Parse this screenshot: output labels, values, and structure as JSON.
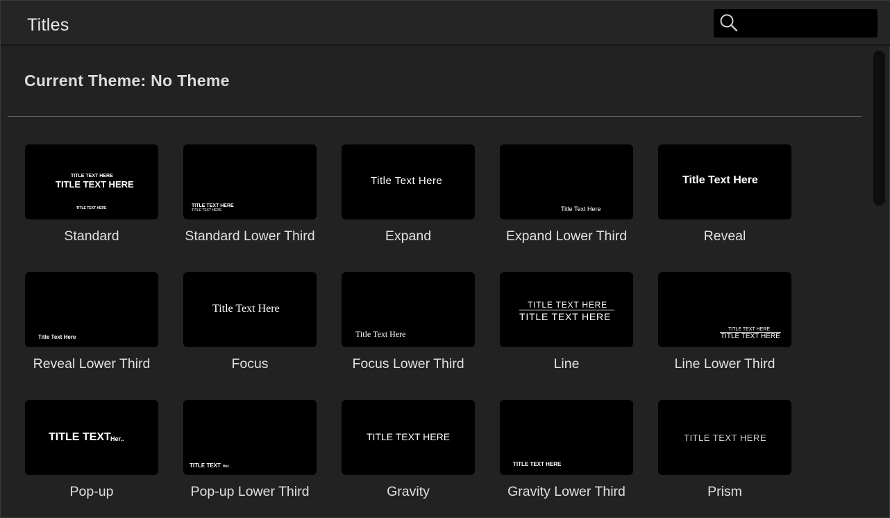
{
  "header": {
    "title": "Titles"
  },
  "search": {
    "placeholder": ""
  },
  "theme": {
    "label": "Current Theme: No Theme"
  },
  "tiles": [
    {
      "label": "Standard",
      "preview": [
        "TITLE TEXT HERE",
        "TITLE TEXT HERE",
        "TITLE TEXT HERE"
      ]
    },
    {
      "label": "Standard Lower Third",
      "preview": [
        "TITLE TEXT HERE",
        "TITLE TEXT HERE"
      ]
    },
    {
      "label": "Expand",
      "preview": [
        "Title Text Here"
      ]
    },
    {
      "label": "Expand Lower Third",
      "preview": [
        "Title Text Here"
      ]
    },
    {
      "label": "Reveal",
      "preview": [
        "Title Text Here"
      ]
    },
    {
      "label": "Reveal Lower Third",
      "preview": [
        "Title Text Here"
      ]
    },
    {
      "label": "Focus",
      "preview": [
        "Title Text Here"
      ]
    },
    {
      "label": "Focus Lower Third",
      "preview": [
        "Title Text Here"
      ]
    },
    {
      "label": "Line",
      "preview": [
        "TITLE TEXT HERE",
        "TITLE TEXT HERE"
      ]
    },
    {
      "label": "Line Lower Third",
      "preview": [
        "TITLE TEXT HERE",
        "TITLE TEXT HERE"
      ]
    },
    {
      "label": "Pop-up",
      "preview": [
        "TITLE TEXT",
        "Her.."
      ]
    },
    {
      "label": "Pop-up Lower Third",
      "preview": [
        "TITLE TEXT",
        "Her.."
      ]
    },
    {
      "label": "Gravity",
      "preview": [
        "TITLE TEXT HERE"
      ]
    },
    {
      "label": "Gravity Lower Third",
      "preview": [
        "TITLE TEXT HERE"
      ]
    },
    {
      "label": "Prism",
      "preview": [
        "TITLE TEXT HERE"
      ]
    }
  ]
}
